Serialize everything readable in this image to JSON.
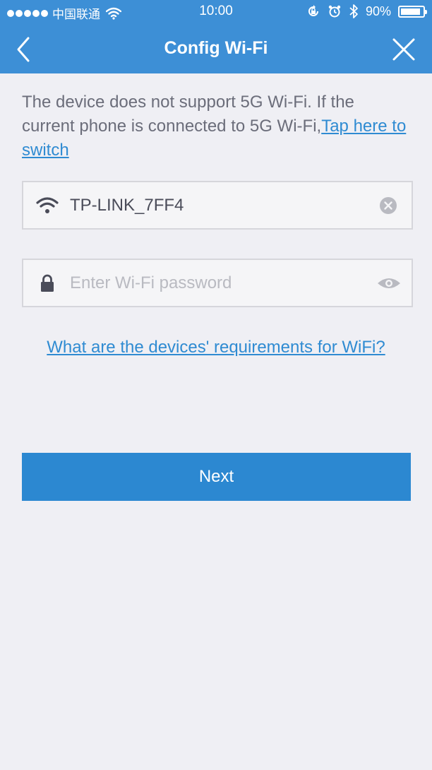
{
  "status_bar": {
    "carrier": "中国联通",
    "time": "10:00",
    "battery_text": "90%",
    "battery_level": 0.9,
    "icons": [
      "signal-dots-icon",
      "wifi-icon",
      "rotation-lock-icon",
      "alarm-icon",
      "bluetooth-icon",
      "battery-icon"
    ]
  },
  "nav": {
    "title": "Config Wi-Fi",
    "back_icon": "chevron-left-icon",
    "close_icon": "close-icon"
  },
  "notice": {
    "text": "The device does not support 5G Wi-Fi. If the current phone is connected to 5G Wi-Fi,",
    "link": "Tap here to switch"
  },
  "ssid_field": {
    "value": "TP-LINK_7FF4",
    "lead_icon": "wifi-icon",
    "action_icon": "clear-icon"
  },
  "password_field": {
    "placeholder": "Enter Wi-Fi password",
    "value": "",
    "lead_icon": "lock-icon",
    "action_icon": "eye-icon"
  },
  "requirements_link": "What are the devices' requirements for WiFi?",
  "next_button": "Next",
  "colors": {
    "header": "#3d8fd6",
    "accent": "#2c88d1",
    "background": "#efeff4",
    "link": "#2f8bd2"
  }
}
